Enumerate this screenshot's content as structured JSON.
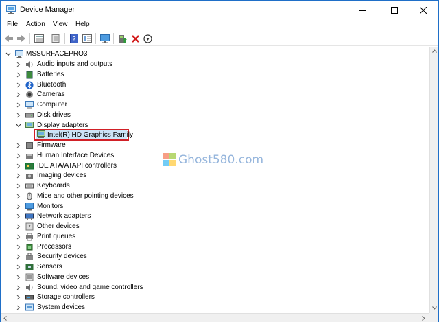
{
  "window": {
    "title": "Device Manager"
  },
  "menu": [
    "File",
    "Action",
    "View",
    "Help"
  ],
  "toolbar": {
    "icons": [
      "back-arrow-icon",
      "forward-arrow-icon",
      "properties-grid-icon",
      "scan-icon",
      "help-icon",
      "view-icon",
      "monitor-icon",
      "update-driver-icon",
      "uninstall-icon",
      "disable-icon"
    ]
  },
  "tree": {
    "root": "MSSURFACEPRO3",
    "categories": [
      {
        "label": "Audio inputs and outputs",
        "icon": "speaker-icon",
        "expanded": false
      },
      {
        "label": "Batteries",
        "icon": "battery-icon",
        "expanded": false
      },
      {
        "label": "Bluetooth",
        "icon": "bluetooth-icon",
        "expanded": false
      },
      {
        "label": "Cameras",
        "icon": "camera-icon",
        "expanded": false
      },
      {
        "label": "Computer",
        "icon": "computer-icon",
        "expanded": false
      },
      {
        "label": "Disk drives",
        "icon": "disk-icon",
        "expanded": false
      },
      {
        "label": "Display adapters",
        "icon": "display-adapter-icon",
        "expanded": true,
        "children": [
          "Intel(R) HD Graphics Family"
        ]
      },
      {
        "label": "Firmware",
        "icon": "firmware-icon",
        "expanded": false
      },
      {
        "label": "Human Interface Devices",
        "icon": "hid-icon",
        "expanded": false
      },
      {
        "label": "IDE ATA/ATAPI controllers",
        "icon": "ide-icon",
        "expanded": false
      },
      {
        "label": "Imaging devices",
        "icon": "imaging-icon",
        "expanded": false
      },
      {
        "label": "Keyboards",
        "icon": "keyboard-icon",
        "expanded": false
      },
      {
        "label": "Mice and other pointing devices",
        "icon": "mouse-icon",
        "expanded": false
      },
      {
        "label": "Monitors",
        "icon": "monitor-icon",
        "expanded": false
      },
      {
        "label": "Network adapters",
        "icon": "network-icon",
        "expanded": false
      },
      {
        "label": "Other devices",
        "icon": "other-device-icon",
        "expanded": false
      },
      {
        "label": "Print queues",
        "icon": "printer-icon",
        "expanded": false
      },
      {
        "label": "Processors",
        "icon": "processor-icon",
        "expanded": false
      },
      {
        "label": "Security devices",
        "icon": "security-icon",
        "expanded": false
      },
      {
        "label": "Sensors",
        "icon": "sensor-icon",
        "expanded": false
      },
      {
        "label": "Software devices",
        "icon": "software-icon",
        "expanded": false
      },
      {
        "label": "Sound, video and game controllers",
        "icon": "sound-icon",
        "expanded": false
      },
      {
        "label": "Storage controllers",
        "icon": "storage-icon",
        "expanded": false
      },
      {
        "label": "System devices",
        "icon": "system-icon",
        "expanded": false
      }
    ],
    "selected": "Intel(R) HD Graphics Family"
  },
  "watermark": {
    "text": "Ghost580.com"
  },
  "colors": {
    "highlight_border": "#d12027",
    "selection": "#cce4f7",
    "window_border": "#1f6fc8"
  }
}
